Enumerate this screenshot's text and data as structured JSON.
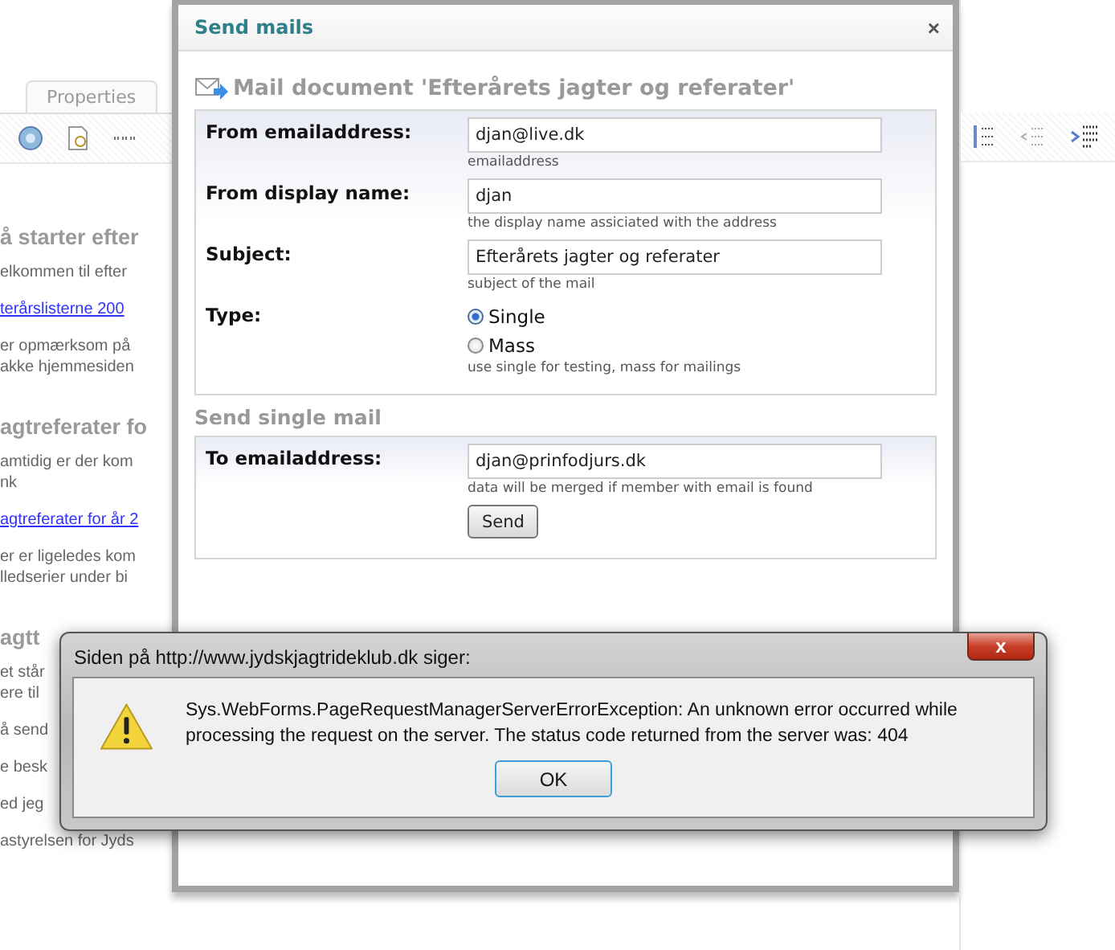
{
  "background_page": {
    "tabs": [
      {
        "label": "Properties",
        "selected": false
      }
    ],
    "content": [
      {
        "kind": "heading",
        "lines": [
          "å starter efter"
        ]
      },
      {
        "kind": "paragraph",
        "lines": [
          "elkommen til efter"
        ]
      },
      {
        "kind": "link",
        "lines": [
          "terårslisterne 200"
        ]
      },
      {
        "kind": "paragraph",
        "lines": [
          "er opmærksom på",
          "akke hjemmesiden"
        ]
      },
      {
        "kind": "heading",
        "lines": [
          "agtreferater fo"
        ]
      },
      {
        "kind": "paragraph",
        "lines": [
          "amtidig er der kom",
          "nk"
        ]
      },
      {
        "kind": "link",
        "lines": [
          "agtreferater for år 2"
        ]
      },
      {
        "kind": "paragraph",
        "lines": [
          "er er ligeledes kom",
          "lledserier under bi"
        ]
      },
      {
        "kind": "heading",
        "lines": [
          "agtt"
        ]
      },
      {
        "kind": "paragraph",
        "lines": [
          "et står",
          "ere til"
        ]
      },
      {
        "kind": "paragraph",
        "lines": [
          "å send"
        ]
      },
      {
        "kind": "paragraph",
        "lines": [
          "e besk"
        ]
      },
      {
        "kind": "paragraph",
        "lines": [
          "ed jeg"
        ]
      },
      {
        "kind": "paragraph",
        "lines": [
          "astyrelsen for Jyds"
        ]
      }
    ]
  },
  "modal": {
    "title": "Send mails",
    "close": "×",
    "heading": "Mail document 'Efterårets jagter og referater'",
    "fields": [
      {
        "kind": "text",
        "label": "From emailaddress:",
        "value": "djan@live.dk",
        "hint": "emailaddress"
      },
      {
        "kind": "text",
        "label": "From display name:",
        "value": "djan",
        "hint": "the display name assiciated with the address"
      },
      {
        "kind": "text",
        "label": "Subject:",
        "value": "Efterårets jagter og referater",
        "hint": "subject of the mail"
      },
      {
        "kind": "radio",
        "label": "Type:",
        "options": [
          {
            "label": "Single",
            "selected": true
          },
          {
            "label": "Mass",
            "selected": false
          }
        ],
        "hint": "use single for testing, mass for mailings"
      }
    ],
    "section_title": "Send single mail",
    "single": {
      "label": "To emailaddress:",
      "value": "djan@prinfodjurs.dk",
      "hint": "data will be merged if member with email is found",
      "button": "Send"
    }
  },
  "alert": {
    "title": "Siden på http://www.jydskjagtrideklub.dk siger:",
    "close": "x",
    "message": "Sys.WebForms.PageRequestManagerServerErrorException: An unknown error occurred while processing the request on the server. The status code returned from the server was: 404",
    "button": "OK"
  }
}
